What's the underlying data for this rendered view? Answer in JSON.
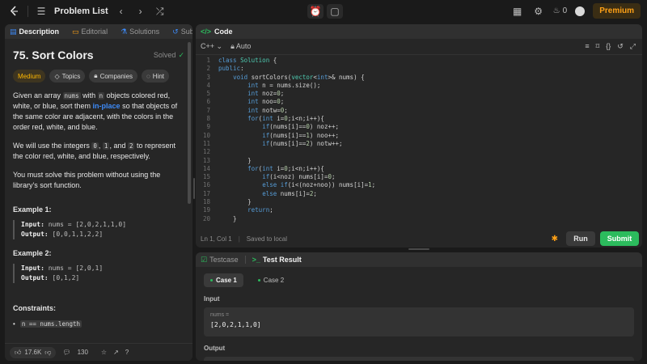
{
  "topbar": {
    "title": "Problem List",
    "streak": "0",
    "premium": "Premium"
  },
  "left": {
    "tabs": [
      "Description",
      "Editorial",
      "Solutions",
      "Submissio"
    ],
    "title": "75. Sort Colors",
    "status": "Solved",
    "chips": [
      "Medium",
      "Topics",
      "Companies",
      "Hint"
    ],
    "para1": {
      "a": "Given an array ",
      "b": "nums",
      "c": " with ",
      "d": "n",
      "e": " objects colored red, white, or blue, sort them ",
      "link": "in-place",
      "f": " so that objects of the same color are adjacent, with the colors in the order red, white, and blue."
    },
    "para2": {
      "a": "We will use the integers ",
      "b": "0",
      "c": ", ",
      "d": "1",
      "e": ", and ",
      "f": "2",
      "g": " to represent the color red, white, and blue, respectively."
    },
    "para3": "You must solve this problem without using the library's sort function.",
    "examples": [
      {
        "title": "Example 1:",
        "input_label": "Input:",
        "input": " nums = [2,0,2,1,1,0]",
        "output_label": "Output:",
        "output": " [0,0,1,1,2,2]"
      },
      {
        "title": "Example 2:",
        "input_label": "Input:",
        "input": " nums = [2,0,1]",
        "output_label": "Output:",
        "output": " [0,1,2]"
      }
    ],
    "constraints_title": "Constraints:",
    "constraint1": "n == nums.length",
    "footer": {
      "likes": "17.6K",
      "comments": "130"
    }
  },
  "code": {
    "tab": "Code",
    "language": "C++",
    "mode": "Auto",
    "lines": [
      "class Solution {",
      "public:",
      "    void sortColors(vector<int>& nums) {",
      "        int n = nums.size();",
      "        int noz=0;",
      "        int noo=0;",
      "        int notw=0;",
      "        for(int i=0;i<n;i++){",
      "            if(nums[i]==0) noz++;",
      "            if(nums[i]==1) noo++;",
      "            if(nums[i]==2) notw++;",
      "",
      "        }",
      "        for(int i=0;i<n;i++){",
      "            if(i<noz) nums[i]=0;",
      "            else if(i<(noz+noo)) nums[i]=1;",
      "            else nums[i]=2;",
      "        }",
      "        return;",
      "    }"
    ],
    "status": "Ln 1, Col 1",
    "saved": "Saved to local",
    "run": "Run",
    "submit": "Submit"
  },
  "test": {
    "tabs": [
      "Testcase",
      "Test Result"
    ],
    "cases": [
      "Case 1",
      "Case 2"
    ],
    "input_label": "Input",
    "var_name": "nums =",
    "var_value": "[2,0,2,1,1,0]",
    "output_label": "Output"
  }
}
